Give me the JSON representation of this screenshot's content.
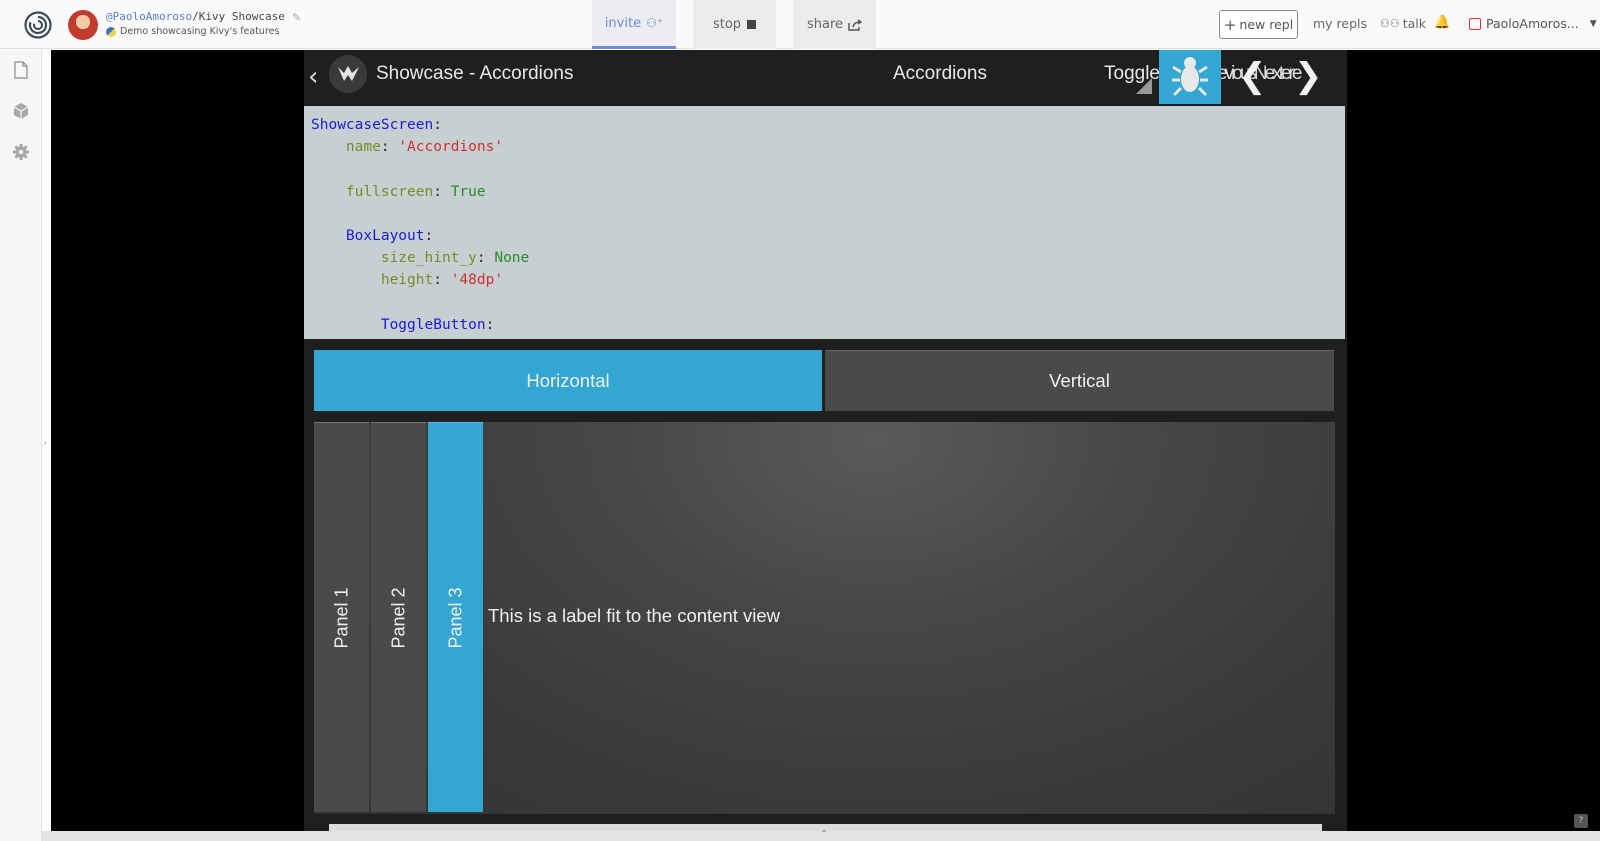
{
  "header": {
    "owner": "@PaoloAmoroso",
    "separator": "/",
    "repl_name": "Kivy Showcase",
    "description": "Demo showcasing Kivy's features",
    "invite_label": "invite",
    "stop_label": "stop",
    "share_label": "share",
    "new_repl_label": "new repl",
    "my_repls_label": "my repls",
    "talk_label": "talk",
    "username": "PaoloAmoros..."
  },
  "colors": {
    "accent": "#33a6d2",
    "invite": "#6b8ed6"
  },
  "icons": {
    "logo": "replit-logo-icon",
    "files": "file-icon",
    "packages": "package-icon",
    "settings": "gear-icon",
    "notifications": "bell-icon"
  },
  "app": {
    "title": "Showcase - Accordions",
    "breadcrumb": "Accordions",
    "overflow_text_1": "Toggle",
    "overflow_text_2": "PreviousNextere",
    "code_lines": [
      [
        {
          "t": "ShowcaseScreen",
          "c": "cls"
        },
        {
          "t": ":",
          "c": "punc"
        }
      ],
      [
        {
          "t": "    ",
          "c": "punc"
        },
        {
          "t": "name",
          "c": "key"
        },
        {
          "t": ": ",
          "c": "punc"
        },
        {
          "t": "'Accordions'",
          "c": "str"
        }
      ],
      [],
      [
        {
          "t": "    ",
          "c": "punc"
        },
        {
          "t": "fullscreen",
          "c": "key"
        },
        {
          "t": ": ",
          "c": "punc"
        },
        {
          "t": "True",
          "c": "val"
        }
      ],
      [],
      [
        {
          "t": "    ",
          "c": "punc"
        },
        {
          "t": "BoxLayout",
          "c": "cls"
        },
        {
          "t": ":",
          "c": "punc"
        }
      ],
      [
        {
          "t": "        ",
          "c": "punc"
        },
        {
          "t": "size_hint_y",
          "c": "key"
        },
        {
          "t": ": ",
          "c": "punc"
        },
        {
          "t": "None",
          "c": "val"
        }
      ],
      [
        {
          "t": "        ",
          "c": "punc"
        },
        {
          "t": "height",
          "c": "key"
        },
        {
          "t": ": ",
          "c": "punc"
        },
        {
          "t": "'48dp'",
          "c": "str"
        }
      ],
      [],
      [
        {
          "t": "        ",
          "c": "punc"
        },
        {
          "t": "ToggleButton",
          "c": "cls"
        },
        {
          "t": ":",
          "c": "punc"
        }
      ]
    ],
    "toggle_horizontal": "Horizontal",
    "toggle_vertical": "Vertical",
    "panels": [
      "Panel 1",
      "Panel 2",
      "Panel 3"
    ],
    "active_panel_index": 2,
    "content_label": "This is a label fit to the content view"
  }
}
